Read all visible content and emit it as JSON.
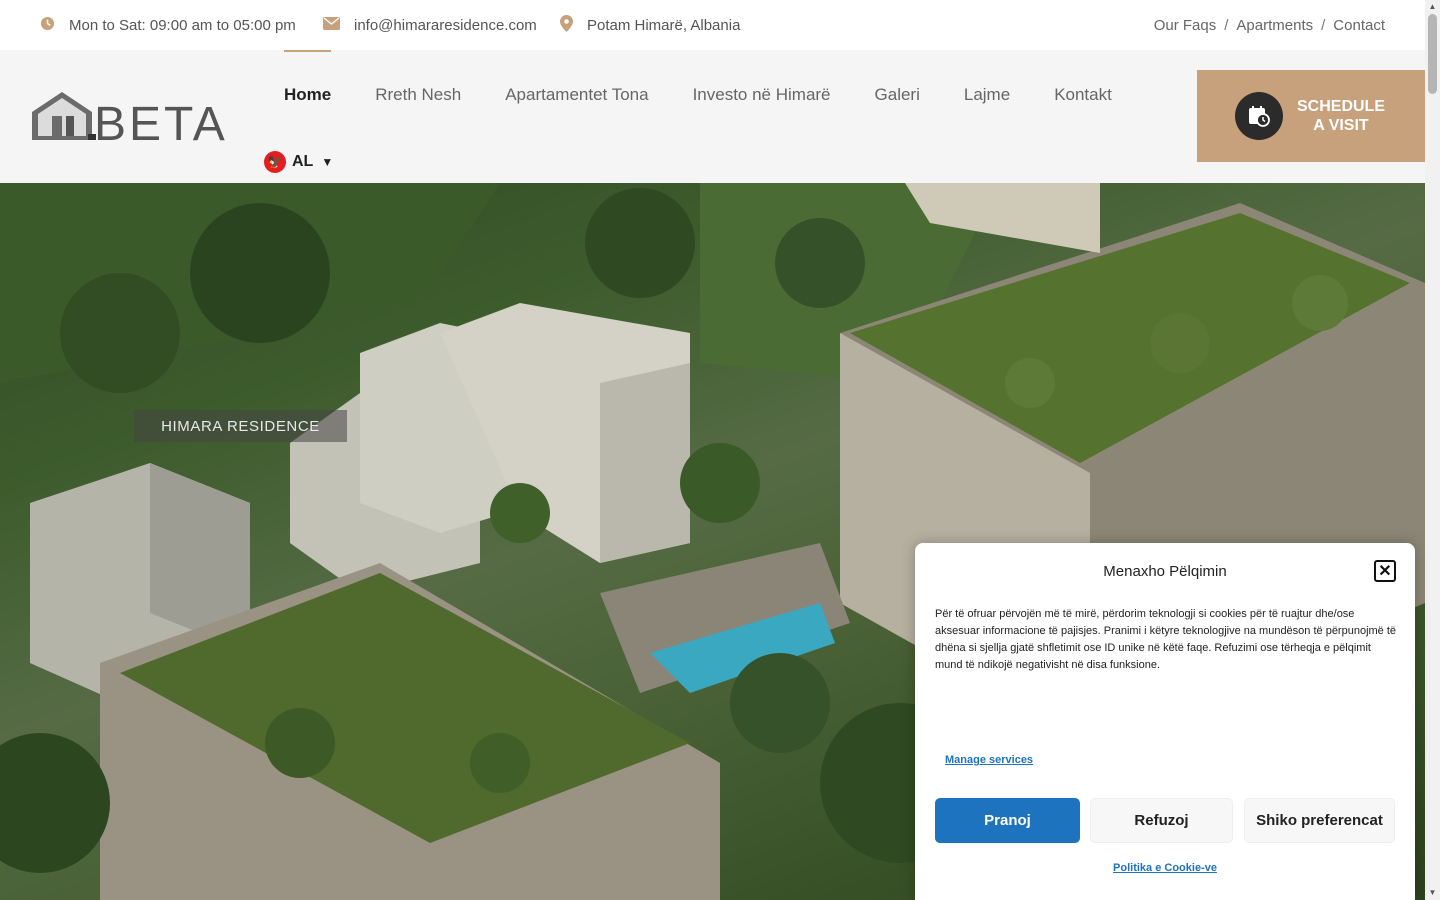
{
  "topbar": {
    "hours": "Mon to Sat: 09:00 am to 05:00 pm",
    "email": "info@himararesidence.com",
    "location": "Potam Himarë, Albania",
    "links": [
      "Our Faqs",
      "Apartments",
      "Contact"
    ],
    "separator": "/",
    "icons": [
      "clock-icon",
      "envelope-icon",
      "map-pin-icon"
    ]
  },
  "header": {
    "logo_text": "BETA",
    "nav": [
      "Home",
      "Rreth Nesh",
      "Apartamentet Tona",
      "Investo në Himarë",
      "Galeri",
      "Lajme",
      "Kontakt"
    ],
    "active_nav": "Home",
    "language": "AL",
    "cta_line1": "SCHEDULE",
    "cta_line2": "A VISIT"
  },
  "hero": {
    "badge": "HIMARA RESIDENCE"
  },
  "cookie": {
    "title": "Menaxho Pëlqimin",
    "body": "Për të ofruar përvojën më të mirë, përdorim teknologji si cookies për të ruajtur dhe/ose aksesuar informacione të pajisjes. Pranimi i këtyre teknologjive na mundëson të përpunojmë të dhëna si sjellja gjatë shfletimit ose ID unike në këtë faqe. Refuzimi ose tërheqja e pëlqimit mund të ndikojë negativisht në disa funksione.",
    "manage": "Manage services",
    "accept": "Pranoj",
    "deny": "Refuzoj",
    "preferences": "Shiko preferencat",
    "policy": "Politika e Cookie-ve"
  },
  "colors": {
    "accent": "#c6a17b",
    "primary_button": "#1e73be",
    "header_bg": "#f5f5f5"
  }
}
